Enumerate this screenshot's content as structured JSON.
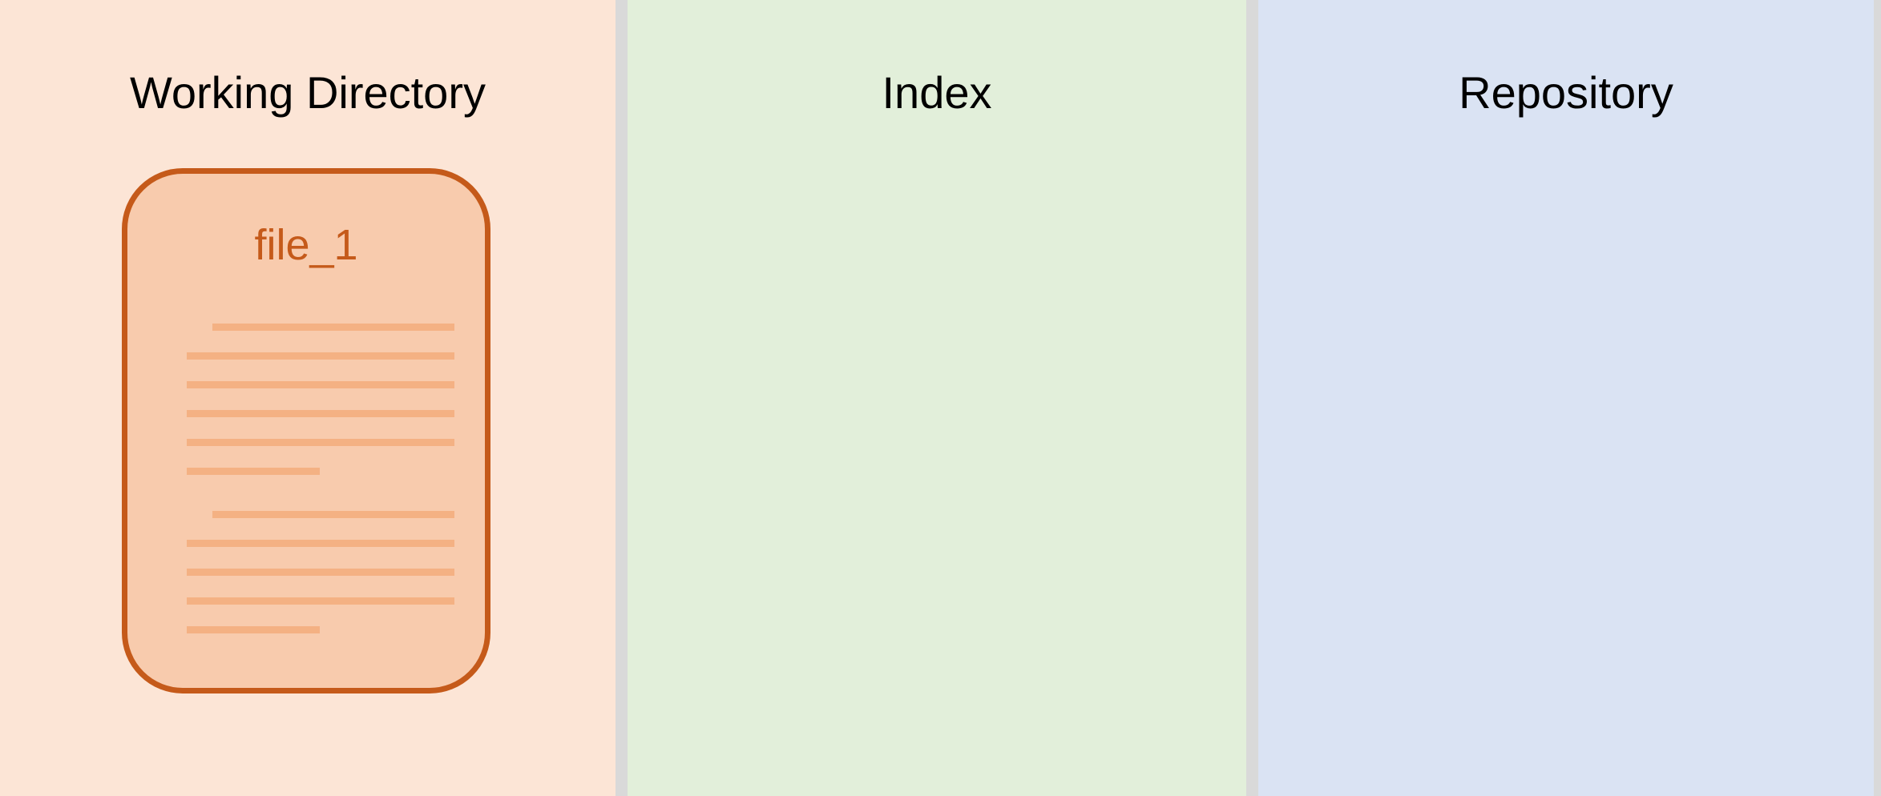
{
  "columns": [
    {
      "title": "Working Directory",
      "color": "#fce5d6"
    },
    {
      "title": "Index",
      "color": "#e2efda"
    },
    {
      "title": "Repository",
      "color": "#dae3f3"
    }
  ],
  "file": {
    "name": "file_1",
    "border_color": "#c55a1a",
    "fill_color": "#f8cbad",
    "line_color": "#f4b183"
  }
}
